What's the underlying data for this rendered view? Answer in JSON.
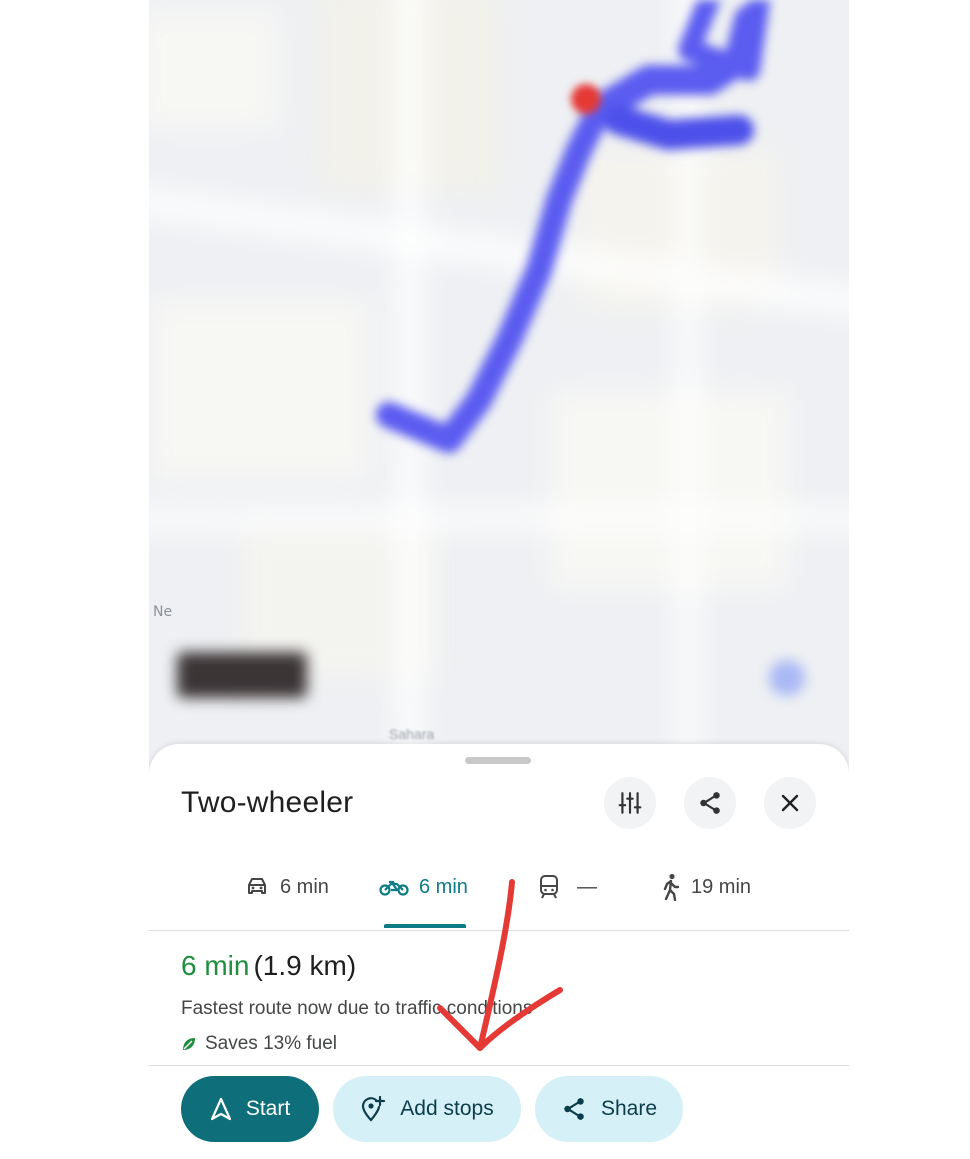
{
  "map": {
    "label_partial_left": "Ne",
    "label_bottom": "Sahara"
  },
  "sheet": {
    "title": "Two-wheeler",
    "header_icons": [
      "route-options-icon",
      "share-icon",
      "close-icon"
    ]
  },
  "modes": [
    {
      "icon": "car-icon",
      "label": "6 min",
      "selected": false
    },
    {
      "icon": "motorbike-icon",
      "label": "6 min",
      "selected": true
    },
    {
      "icon": "transit-icon",
      "label": "—",
      "selected": false
    },
    {
      "icon": "walk-icon",
      "label": "19 min",
      "selected": false
    }
  ],
  "route": {
    "time": "6 min",
    "distance": "(1.9 km)",
    "description": "Fastest route now due to traffic conditions",
    "fuel_note": "Saves 13% fuel"
  },
  "actions": {
    "start_label": "Start",
    "add_stops_label": "Add stops",
    "share_label": "Share"
  },
  "colors": {
    "accent_teal": "#0e6f7a",
    "time_green": "#1e8e3e",
    "chip_bg": "#d6f0f7",
    "route_blue": "#5b5cf0",
    "annotation_red": "#e53935"
  }
}
